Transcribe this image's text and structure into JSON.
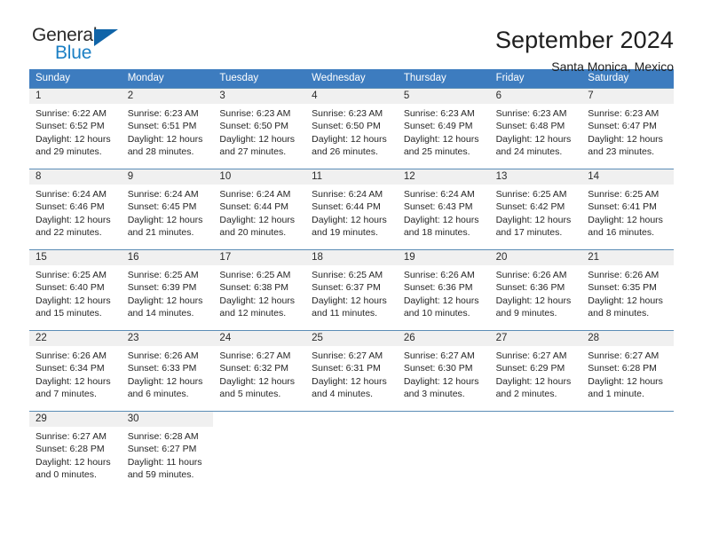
{
  "brand": {
    "name_part1": "General",
    "name_part2": "Blue",
    "flag_icon": "blue-triangle-flag-icon",
    "colors": {
      "text": "#2b2b2b",
      "blue": "#1b7fc4",
      "flag": "#1064a8"
    }
  },
  "header": {
    "title": "September 2024",
    "subtitle": "Santa Monica, Mexico"
  },
  "theme": {
    "header_blue": "#3d7cbf",
    "day_number_bg": "#f0f0f0",
    "row_border": "#5b8db6"
  },
  "calendar": {
    "weekdays": [
      "Sunday",
      "Monday",
      "Tuesday",
      "Wednesday",
      "Thursday",
      "Friday",
      "Saturday"
    ],
    "weeks": [
      [
        {
          "day": "1",
          "sunrise": "Sunrise: 6:22 AM",
          "sunset": "Sunset: 6:52 PM",
          "daylight_line1": "Daylight: 12 hours",
          "daylight_line2": "and 29 minutes."
        },
        {
          "day": "2",
          "sunrise": "Sunrise: 6:23 AM",
          "sunset": "Sunset: 6:51 PM",
          "daylight_line1": "Daylight: 12 hours",
          "daylight_line2": "and 28 minutes."
        },
        {
          "day": "3",
          "sunrise": "Sunrise: 6:23 AM",
          "sunset": "Sunset: 6:50 PM",
          "daylight_line1": "Daylight: 12 hours",
          "daylight_line2": "and 27 minutes."
        },
        {
          "day": "4",
          "sunrise": "Sunrise: 6:23 AM",
          "sunset": "Sunset: 6:50 PM",
          "daylight_line1": "Daylight: 12 hours",
          "daylight_line2": "and 26 minutes."
        },
        {
          "day": "5",
          "sunrise": "Sunrise: 6:23 AM",
          "sunset": "Sunset: 6:49 PM",
          "daylight_line1": "Daylight: 12 hours",
          "daylight_line2": "and 25 minutes."
        },
        {
          "day": "6",
          "sunrise": "Sunrise: 6:23 AM",
          "sunset": "Sunset: 6:48 PM",
          "daylight_line1": "Daylight: 12 hours",
          "daylight_line2": "and 24 minutes."
        },
        {
          "day": "7",
          "sunrise": "Sunrise: 6:23 AM",
          "sunset": "Sunset: 6:47 PM",
          "daylight_line1": "Daylight: 12 hours",
          "daylight_line2": "and 23 minutes."
        }
      ],
      [
        {
          "day": "8",
          "sunrise": "Sunrise: 6:24 AM",
          "sunset": "Sunset: 6:46 PM",
          "daylight_line1": "Daylight: 12 hours",
          "daylight_line2": "and 22 minutes."
        },
        {
          "day": "9",
          "sunrise": "Sunrise: 6:24 AM",
          "sunset": "Sunset: 6:45 PM",
          "daylight_line1": "Daylight: 12 hours",
          "daylight_line2": "and 21 minutes."
        },
        {
          "day": "10",
          "sunrise": "Sunrise: 6:24 AM",
          "sunset": "Sunset: 6:44 PM",
          "daylight_line1": "Daylight: 12 hours",
          "daylight_line2": "and 20 minutes."
        },
        {
          "day": "11",
          "sunrise": "Sunrise: 6:24 AM",
          "sunset": "Sunset: 6:44 PM",
          "daylight_line1": "Daylight: 12 hours",
          "daylight_line2": "and 19 minutes."
        },
        {
          "day": "12",
          "sunrise": "Sunrise: 6:24 AM",
          "sunset": "Sunset: 6:43 PM",
          "daylight_line1": "Daylight: 12 hours",
          "daylight_line2": "and 18 minutes."
        },
        {
          "day": "13",
          "sunrise": "Sunrise: 6:25 AM",
          "sunset": "Sunset: 6:42 PM",
          "daylight_line1": "Daylight: 12 hours",
          "daylight_line2": "and 17 minutes."
        },
        {
          "day": "14",
          "sunrise": "Sunrise: 6:25 AM",
          "sunset": "Sunset: 6:41 PM",
          "daylight_line1": "Daylight: 12 hours",
          "daylight_line2": "and 16 minutes."
        }
      ],
      [
        {
          "day": "15",
          "sunrise": "Sunrise: 6:25 AM",
          "sunset": "Sunset: 6:40 PM",
          "daylight_line1": "Daylight: 12 hours",
          "daylight_line2": "and 15 minutes."
        },
        {
          "day": "16",
          "sunrise": "Sunrise: 6:25 AM",
          "sunset": "Sunset: 6:39 PM",
          "daylight_line1": "Daylight: 12 hours",
          "daylight_line2": "and 14 minutes."
        },
        {
          "day": "17",
          "sunrise": "Sunrise: 6:25 AM",
          "sunset": "Sunset: 6:38 PM",
          "daylight_line1": "Daylight: 12 hours",
          "daylight_line2": "and 12 minutes."
        },
        {
          "day": "18",
          "sunrise": "Sunrise: 6:25 AM",
          "sunset": "Sunset: 6:37 PM",
          "daylight_line1": "Daylight: 12 hours",
          "daylight_line2": "and 11 minutes."
        },
        {
          "day": "19",
          "sunrise": "Sunrise: 6:26 AM",
          "sunset": "Sunset: 6:36 PM",
          "daylight_line1": "Daylight: 12 hours",
          "daylight_line2": "and 10 minutes."
        },
        {
          "day": "20",
          "sunrise": "Sunrise: 6:26 AM",
          "sunset": "Sunset: 6:36 PM",
          "daylight_line1": "Daylight: 12 hours",
          "daylight_line2": "and 9 minutes."
        },
        {
          "day": "21",
          "sunrise": "Sunrise: 6:26 AM",
          "sunset": "Sunset: 6:35 PM",
          "daylight_line1": "Daylight: 12 hours",
          "daylight_line2": "and 8 minutes."
        }
      ],
      [
        {
          "day": "22",
          "sunrise": "Sunrise: 6:26 AM",
          "sunset": "Sunset: 6:34 PM",
          "daylight_line1": "Daylight: 12 hours",
          "daylight_line2": "and 7 minutes."
        },
        {
          "day": "23",
          "sunrise": "Sunrise: 6:26 AM",
          "sunset": "Sunset: 6:33 PM",
          "daylight_line1": "Daylight: 12 hours",
          "daylight_line2": "and 6 minutes."
        },
        {
          "day": "24",
          "sunrise": "Sunrise: 6:27 AM",
          "sunset": "Sunset: 6:32 PM",
          "daylight_line1": "Daylight: 12 hours",
          "daylight_line2": "and 5 minutes."
        },
        {
          "day": "25",
          "sunrise": "Sunrise: 6:27 AM",
          "sunset": "Sunset: 6:31 PM",
          "daylight_line1": "Daylight: 12 hours",
          "daylight_line2": "and 4 minutes."
        },
        {
          "day": "26",
          "sunrise": "Sunrise: 6:27 AM",
          "sunset": "Sunset: 6:30 PM",
          "daylight_line1": "Daylight: 12 hours",
          "daylight_line2": "and 3 minutes."
        },
        {
          "day": "27",
          "sunrise": "Sunrise: 6:27 AM",
          "sunset": "Sunset: 6:29 PM",
          "daylight_line1": "Daylight: 12 hours",
          "daylight_line2": "and 2 minutes."
        },
        {
          "day": "28",
          "sunrise": "Sunrise: 6:27 AM",
          "sunset": "Sunset: 6:28 PM",
          "daylight_line1": "Daylight: 12 hours",
          "daylight_line2": "and 1 minute."
        }
      ],
      [
        {
          "day": "29",
          "sunrise": "Sunrise: 6:27 AM",
          "sunset": "Sunset: 6:28 PM",
          "daylight_line1": "Daylight: 12 hours",
          "daylight_line2": "and 0 minutes."
        },
        {
          "day": "30",
          "sunrise": "Sunrise: 6:28 AM",
          "sunset": "Sunset: 6:27 PM",
          "daylight_line1": "Daylight: 11 hours",
          "daylight_line2": "and 59 minutes."
        },
        null,
        null,
        null,
        null,
        null
      ]
    ]
  }
}
